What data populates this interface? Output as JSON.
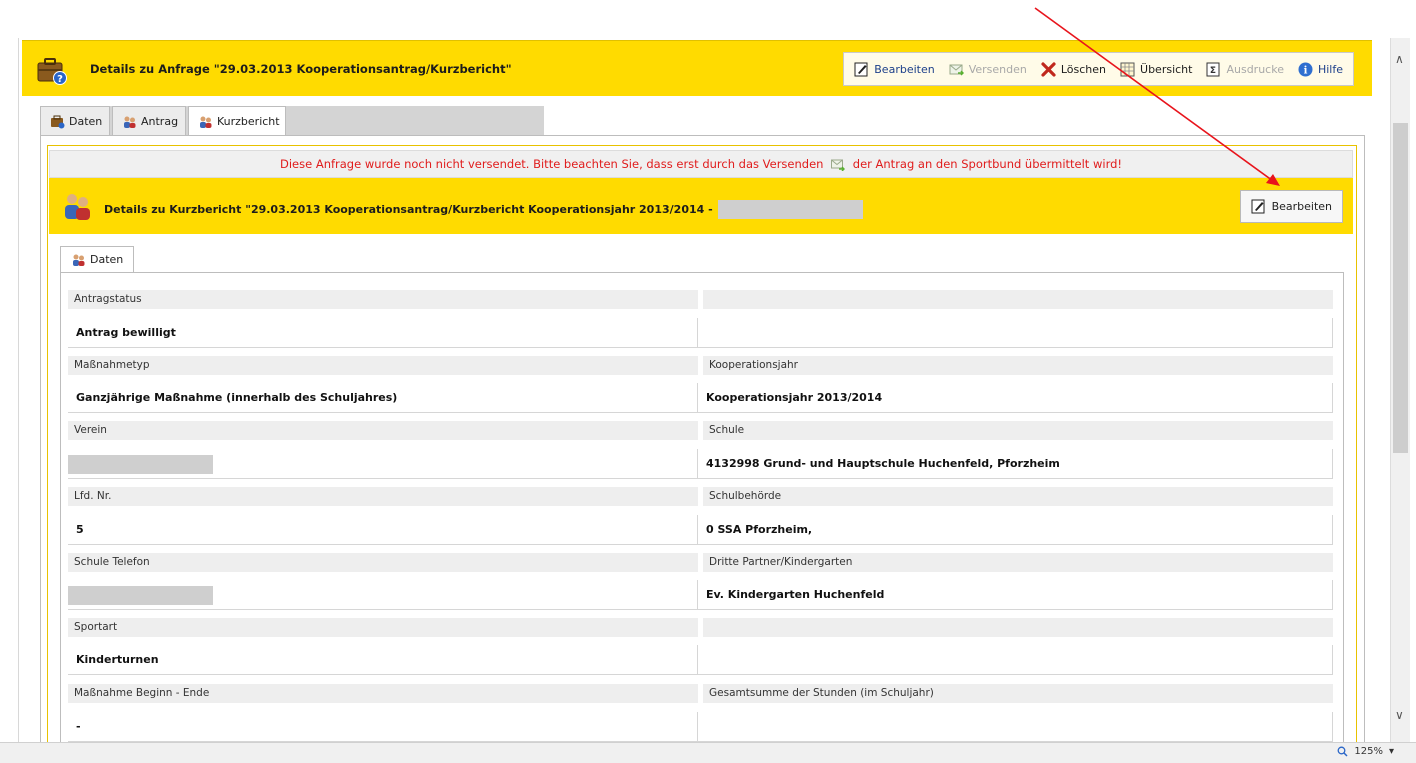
{
  "header": {
    "title": "Details zu  Anfrage \"29.03.2013 Kooperationsantrag/Kurzbericht\"",
    "toolbar": {
      "edit": "Bearbeiten",
      "send": "Versenden",
      "delete": "Löschen",
      "overview": "Übersicht",
      "printouts": "Ausdrucke",
      "help": "Hilfe"
    }
  },
  "tabs": [
    "Daten",
    "Antrag",
    "Kurzbericht"
  ],
  "warning": {
    "before": "Diese Anfrage wurde noch nicht versendet. Bitte beachten Sie, dass erst durch das Versenden",
    "after": "der Antrag an den Sportbund übermittelt wird!"
  },
  "sub": {
    "title": "Details zu Kurzbericht \"29.03.2013 Kooperationsantrag/Kurzbericht Kooperationsjahr 2013/2014 -",
    "edit": "Bearbeiten"
  },
  "inner_tab": "Daten",
  "fields": {
    "antragstatus": {
      "label": "Antragstatus",
      "value": "Antrag bewilligt"
    },
    "massnahmetyp": {
      "label": "Maßnahmetyp",
      "value": "Ganzjährige Maßnahme (innerhalb des Schuljahres)"
    },
    "kooperationsjahr": {
      "label": "Kooperationsjahr",
      "value": "Kooperationsjahr 2013/2014"
    },
    "verein": {
      "label": "Verein",
      "value": ""
    },
    "schule": {
      "label": "Schule",
      "value": "4132998 Grund- und Hauptschule Huchenfeld, Pforzheim"
    },
    "lfd_nr": {
      "label": "Lfd. Nr.",
      "value": "5"
    },
    "schulbehoerde": {
      "label": "Schulbehörde",
      "value": "0 SSA Pforzheim,"
    },
    "schule_telefon": {
      "label": "Schule Telefon",
      "value": ""
    },
    "dritte_partner": {
      "label": "Dritte Partner/Kindergarten",
      "value": "Ev. Kindergarten Huchenfeld"
    },
    "sportart": {
      "label": "Sportart",
      "value": "Kinderturnen"
    },
    "beginn_ende": {
      "label": "Maßnahme Beginn - Ende",
      "value": "-"
    },
    "gesamtsumme": {
      "label": "Gesamtsumme der Stunden (im Schuljahr)",
      "value": ""
    }
  },
  "status_bar": {
    "zoom": "125%"
  },
  "colors": {
    "header_yellow": "#ffdb00",
    "warning_red": "#e01c1c",
    "link_blue": "#1c3f8a",
    "annotation_arrow": "#e8141c"
  }
}
